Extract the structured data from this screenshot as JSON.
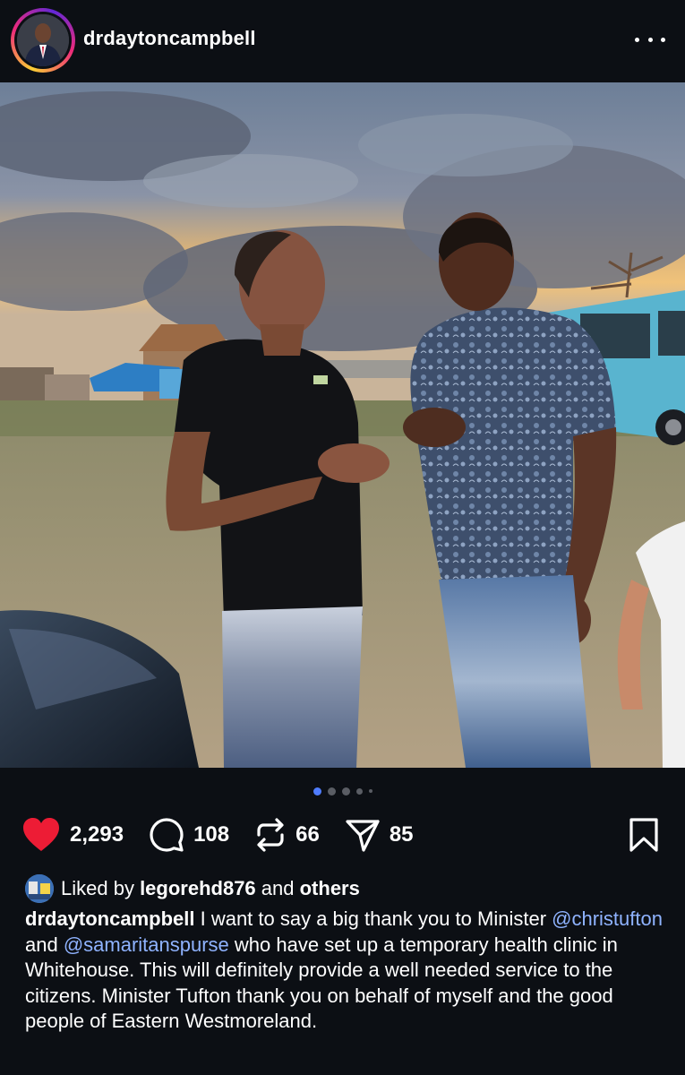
{
  "post": {
    "username": "drdaytoncampbell",
    "more_icon": "more-horizontal-icon"
  },
  "carousel": {
    "total_dots": 5,
    "active_index": 0
  },
  "actions": {
    "likes_count": "2,293",
    "comments_count": "108",
    "reposts_count": "66",
    "shares_count": "85",
    "liked": true,
    "like_color": "#ed1c35"
  },
  "likes": {
    "prefix": "Liked by ",
    "user": "legorehd876",
    "middle": " and ",
    "suffix": "others"
  },
  "caption": {
    "username": "drdaytoncampbell",
    "text_1": " I want to say a big thank you to Minister ",
    "mention_1": "@christufton",
    "text_2": " and ",
    "mention_2": "@samaritanspurse",
    "text_3": " who have set up a temporary health clinic in Whitehouse. This will definitely provide a well needed service to the citizens. Minister Tufton thank you on behalf of myself and the good people of Eastern Westmoreland."
  },
  "theme": {
    "background": "#0c0f14",
    "mention_color": "#8fb3ff",
    "active_dot": "#4f7cff"
  }
}
